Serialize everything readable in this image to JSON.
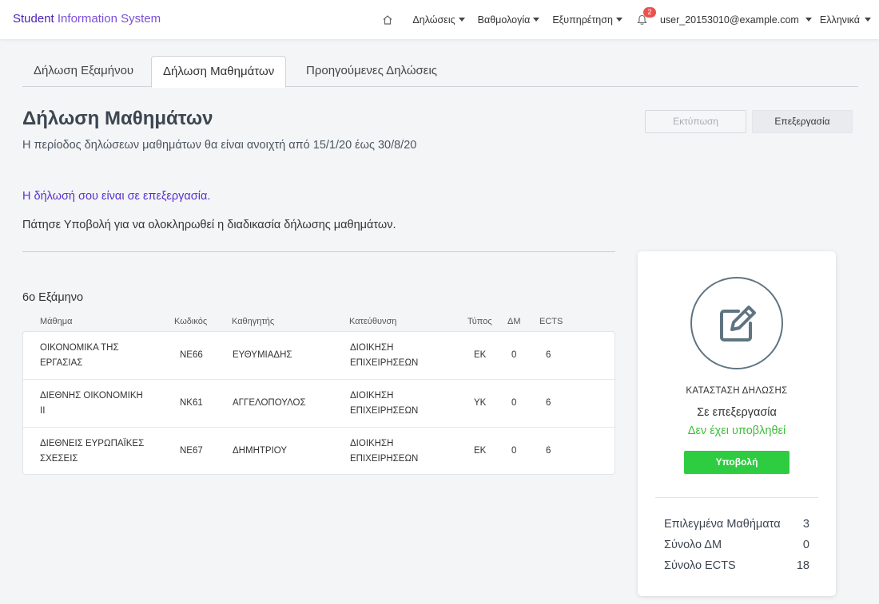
{
  "navbar": {
    "brand_part1": "Student",
    "brand_part2": " Information System",
    "menu_declarations": "Δηλώσεις",
    "menu_grades": "Βαθμολογία",
    "menu_service": "Εξυπηρέτηση",
    "notifications_count": "2",
    "user_email": "user_20153010@example.com",
    "language": "Ελληνικά"
  },
  "tabs": [
    {
      "label": "Δήλωση Εξαμήνου",
      "active": false
    },
    {
      "label": "Δήλωση Μαθημάτων",
      "active": true
    },
    {
      "label": "Προηγούμενες Δηλώσεις",
      "active": false
    }
  ],
  "page": {
    "title": "Δήλωση Μαθημάτων",
    "subtitle": "Η περίοδος δηλώσεων μαθημάτων θα είναι ανοιχτή από 15/1/20 έως 30/8/20",
    "print_button": "Εκτύπωση",
    "edit_button": "Επεξεργασία",
    "status_message": "Η δήλωσή σου είναι σε επεξεργασία.",
    "instruction": "Πάτησε Υποβολή για να ολοκληρωθεί η διαδικασία δήλωσης μαθημάτων."
  },
  "courses": {
    "semester": "6ο Εξάμηνο",
    "headers": {
      "course": "Μάθημα",
      "code": "Κωδικός",
      "professor": "Καθηγητής",
      "direction": "Κατεύθυνση",
      "type": "Τύπος",
      "dm": "ΔΜ",
      "ects": "ECTS"
    },
    "rows": [
      {
        "course_l1": "ΟΙΚΟΝΟΜΙΚΑ ΤΗΣ",
        "course_l2": "ΕΡΓΑΣΙΑΣ",
        "code": "ΝΕ66",
        "professor": "ΕΥΘΥΜΙΑΔΗΣ",
        "direction_l1": "ΔΙΟΙΚΗΣΗ",
        "direction_l2": "ΕΠΙΧΕΙΡΗΣΕΩΝ",
        "type": "ΕΚ",
        "dm": "0",
        "ects": "6"
      },
      {
        "course_l1": "ΔΙΕΘΝΗΣ ΟΙΚΟΝΟΜΙΚΗ",
        "course_l2": "ΙΙ",
        "code": "ΝΚ61",
        "professor": "ΑΓΓΕΛΟΠΟΥΛΟΣ",
        "direction_l1": "ΔΙΟΙΚΗΣΗ",
        "direction_l2": "ΕΠΙΧΕΙΡΗΣΕΩΝ",
        "type": "ΥΚ",
        "dm": "0",
        "ects": "6"
      },
      {
        "course_l1": "ΔΙΕΘΝΕΙΣ ΕΥΡΩΠΑΪΚΕΣ",
        "course_l2": "ΣΧΕΣΕΙΣ",
        "code": "ΝΕ67",
        "professor": "ΔΗΜΗΤΡΙΟΥ",
        "direction_l1": "ΔΙΟΙΚΗΣΗ",
        "direction_l2": "ΕΠΙΧΕΙΡΗΣΕΩΝ",
        "type": "ΕΚ",
        "dm": "0",
        "ects": "6"
      }
    ]
  },
  "status_card": {
    "icon": "edit-icon",
    "label": "ΚΑΤΑΣΤΑΣΗ ΔΗΛΩΣΗΣ",
    "state": "Σε επεξεργασία",
    "sub_state": "Δεν έχει υποβληθεί",
    "submit_button": "Υποβολή",
    "summary": [
      {
        "label": "Επιλεγμένα Μαθήματα",
        "value": "3"
      },
      {
        "label": "Σύνολο ΔΜ",
        "value": "0"
      },
      {
        "label": "Σύνολο ECTS",
        "value": "18"
      }
    ]
  },
  "colors": {
    "brand": "#4a1fb8",
    "status_text": "#5a2fd0",
    "success": "#2ecc40",
    "badge": "#e9534f"
  }
}
